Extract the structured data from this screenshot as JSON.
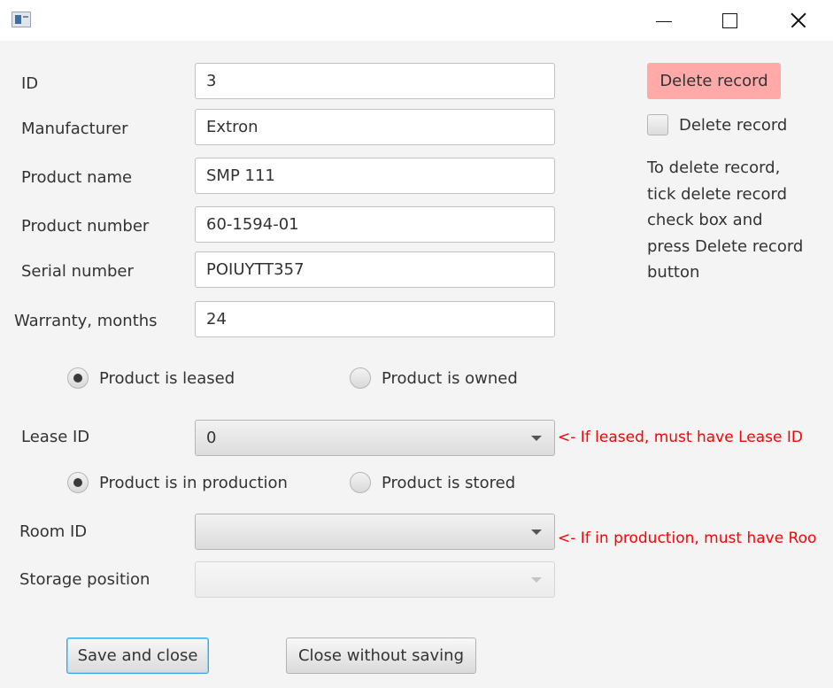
{
  "window": {
    "icon": "app-window-icon",
    "controls": {
      "minimize": "minimize-icon",
      "maximize": "maximize-icon",
      "close": "close-icon"
    }
  },
  "fields": {
    "id": {
      "label": "ID",
      "value": "3"
    },
    "manufacturer": {
      "label": "Manufacturer",
      "value": "Extron"
    },
    "product_name": {
      "label": "Product name",
      "value": "SMP 111"
    },
    "product_number": {
      "label": "Product number",
      "value": "60-1594-01"
    },
    "serial_number": {
      "label": "Serial number",
      "value": "POIUYTT357"
    },
    "warranty": {
      "label": "Warranty, months",
      "value": "24"
    }
  },
  "ownership": {
    "leased": {
      "label": "Product is leased",
      "selected": true
    },
    "owned": {
      "label": "Product is owned",
      "selected": false
    }
  },
  "lease_id": {
    "label": "Lease ID",
    "value": "0",
    "warning": "<- If leased, must have Lease ID"
  },
  "status": {
    "production": {
      "label": "Product is in production",
      "selected": true
    },
    "stored": {
      "label": "Product is stored",
      "selected": false
    }
  },
  "room_id": {
    "label": "Room ID",
    "value": "",
    "warning": "<- If in production, must have Roo"
  },
  "storage_position": {
    "label": "Storage position",
    "value": "",
    "disabled": true
  },
  "delete": {
    "button": "Delete record",
    "checkbox": "Delete record",
    "checked": false,
    "help_lines": [
      "To delete record,",
      "tick delete record",
      "check box and",
      "press Delete record",
      "button"
    ]
  },
  "buttons": {
    "save": "Save and close",
    "close": "Close without saving"
  },
  "colors": {
    "warning": "#ff0000",
    "delete_button": "#ffa9a9",
    "focus_ring": "#39a7e4"
  }
}
